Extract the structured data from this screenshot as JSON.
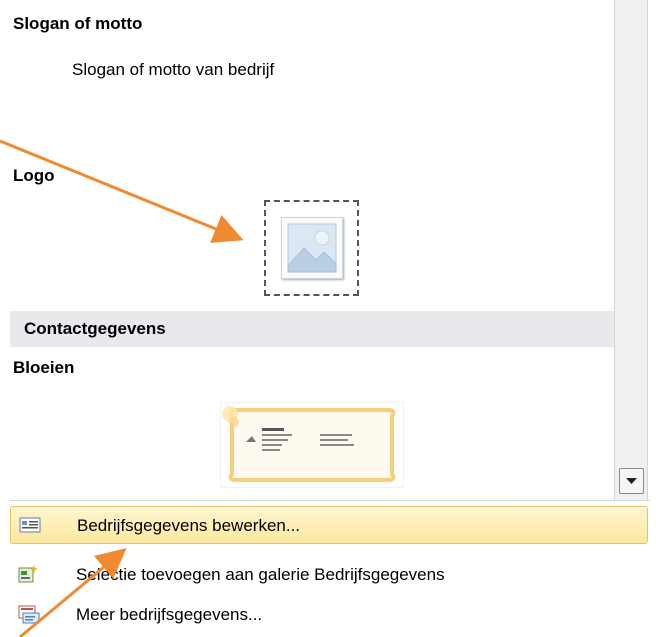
{
  "gallery": {
    "slogan_heading": "Slogan of motto",
    "slogan_text": "Slogan of motto van bedrijf",
    "logo_heading": "Logo"
  },
  "section": {
    "title": "Contactgegevens"
  },
  "contact": {
    "card_name": "Bloeien"
  },
  "menu": {
    "items": [
      {
        "label": "Bedrijfsgegevens bewerken...",
        "icon": "edit-info-icon",
        "highlighted": true
      },
      {
        "label": "Selectie toevoegen aan galerie Bedrijfsgegevens",
        "icon": "add-to-gallery-icon",
        "highlighted": false
      },
      {
        "label": "Meer bedrijfsgegevens...",
        "icon": "more-info-icon",
        "highlighted": false
      }
    ]
  },
  "colors": {
    "arrow": "#f08a30",
    "highlight": "#fde8a0",
    "section_bar": "#e7e9ed"
  }
}
